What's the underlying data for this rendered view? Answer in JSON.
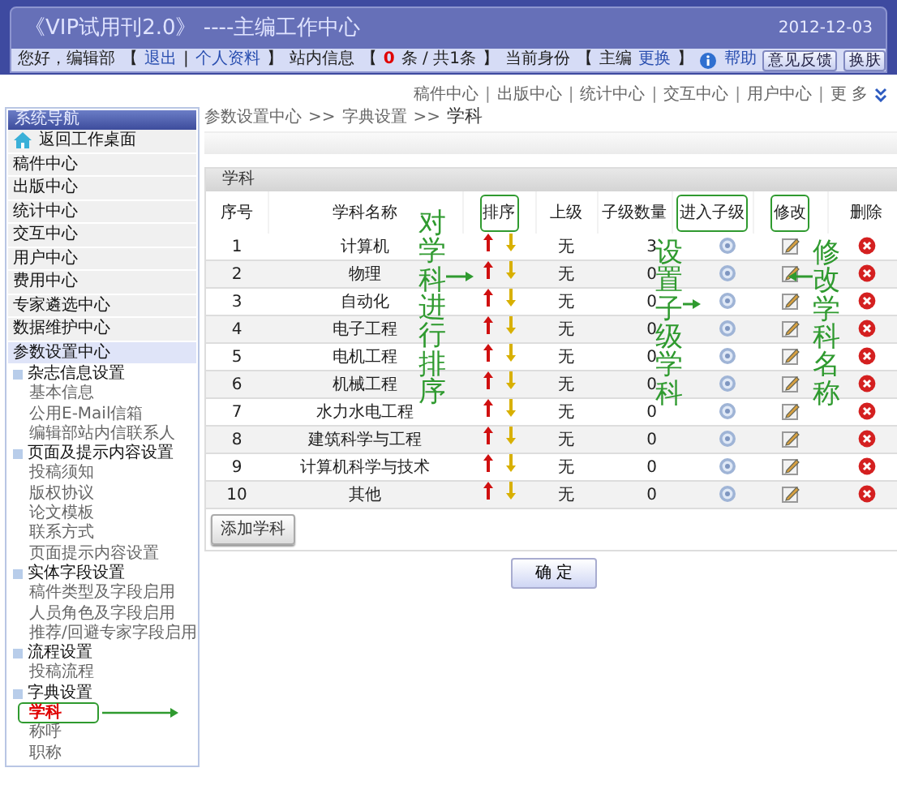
{
  "header": {
    "title": "《VIP试用刊2.0》 ----主编工作中心",
    "date": "2012-12-03"
  },
  "user_bar_left": [
    {
      "kind": "text",
      "text": "您好，编辑部"
    },
    {
      "kind": "text",
      "text": "【"
    },
    {
      "kind": "link",
      "text": "退出"
    },
    {
      "kind": "text",
      "text": "|"
    },
    {
      "kind": "link",
      "text": "个人资料"
    },
    {
      "kind": "text",
      "text": "】"
    }
  ],
  "user_bar_right": [
    {
      "kind": "text",
      "text": "站内信息"
    },
    {
      "kind": "text",
      "text": "【"
    },
    {
      "kind": "count",
      "text": "0"
    },
    {
      "kind": "text",
      "text": "条 / 共1条"
    },
    {
      "kind": "text",
      "text": "】"
    },
    {
      "kind": "text",
      "text": "当前身份"
    },
    {
      "kind": "text",
      "text": "【"
    },
    {
      "kind": "text",
      "text": "主编"
    },
    {
      "kind": "link",
      "text": "更换"
    },
    {
      "kind": "text",
      "text": "】"
    },
    {
      "kind": "help",
      "text": "帮助"
    },
    {
      "kind": "button",
      "text": "意见反馈"
    },
    {
      "kind": "button",
      "text": "换肤"
    }
  ],
  "top_nav": {
    "separator": "|",
    "links": [
      "稿件中心",
      "出版中心",
      "统计中心",
      "交互中心",
      "用户中心"
    ],
    "more": "更 多"
  },
  "sidebar": {
    "title": "系统导航",
    "home": "返回工作桌面",
    "items": [
      {
        "label": "稿件中心",
        "selected": false
      },
      {
        "label": "出版中心",
        "selected": false
      },
      {
        "label": "统计中心",
        "selected": false
      },
      {
        "label": "交互中心",
        "selected": false
      },
      {
        "label": "用户中心",
        "selected": false
      },
      {
        "label": "费用中心",
        "selected": false
      },
      {
        "label": "专家遴选中心",
        "selected": false
      },
      {
        "label": "数据维护中心",
        "selected": false
      },
      {
        "label": "参数设置中心",
        "selected": true,
        "children": [
          {
            "label": "杂志信息设置",
            "children": [
              {
                "label": "基本信息",
                "selected": false,
                "highlighted": false
              },
              {
                "label": "公用E-Mail信箱",
                "selected": false,
                "highlighted": false
              },
              {
                "label": "编辑部站内信联系人",
                "selected": false,
                "highlighted": false
              }
            ]
          },
          {
            "label": "页面及提示内容设置",
            "children": [
              {
                "label": "投稿须知",
                "selected": false,
                "highlighted": false
              },
              {
                "label": "版权协议",
                "selected": false,
                "highlighted": false
              },
              {
                "label": "论文模板",
                "selected": false,
                "highlighted": false
              },
              {
                "label": "联系方式",
                "selected": false,
                "highlighted": false
              },
              {
                "label": "页面提示内容设置",
                "selected": false,
                "highlighted": false
              }
            ]
          },
          {
            "label": "实体字段设置",
            "children": [
              {
                "label": "稿件类型及字段启用",
                "selected": false,
                "highlighted": false
              },
              {
                "label": "人员角色及字段启用",
                "selected": false,
                "highlighted": false
              },
              {
                "label": "推荐/回避专家字段启用",
                "selected": false,
                "highlighted": false
              }
            ]
          },
          {
            "label": "流程设置",
            "children": [
              {
                "label": "投稿流程",
                "selected": false,
                "highlighted": false
              }
            ]
          },
          {
            "label": "字典设置",
            "children": [
              {
                "label": "学科",
                "selected": true,
                "highlighted": true
              },
              {
                "label": "称呼",
                "selected": false,
                "highlighted": false
              },
              {
                "label": "职称",
                "selected": false,
                "highlighted": false
              }
            ]
          }
        ]
      }
    ]
  },
  "breadcrumb": {
    "separator": ">>",
    "items": [
      "参数设置中心",
      "字典设置",
      "学科"
    ]
  },
  "panel": {
    "title": "学科",
    "columns": [
      {
        "label": "序号",
        "highlighted": false
      },
      {
        "label": "学科名称",
        "highlighted": false
      },
      {
        "label": "排序",
        "highlighted": true
      },
      {
        "label": "上级",
        "highlighted": false
      },
      {
        "label": "子级数量",
        "highlighted": false
      },
      {
        "label": "进入子级",
        "highlighted": true
      },
      {
        "label": "修改",
        "highlighted": true
      },
      {
        "label": "删除",
        "highlighted": false
      }
    ],
    "rows": [
      {
        "no": "1",
        "name": "计算机",
        "parent": "无",
        "child_count": "3"
      },
      {
        "no": "2",
        "name": "物理",
        "parent": "无",
        "child_count": "0"
      },
      {
        "no": "3",
        "name": "自动化",
        "parent": "无",
        "child_count": "0"
      },
      {
        "no": "4",
        "name": "电子工程",
        "parent": "无",
        "child_count": "0"
      },
      {
        "no": "5",
        "name": "电机工程",
        "parent": "无",
        "child_count": "0"
      },
      {
        "no": "6",
        "name": "机械工程",
        "parent": "无",
        "child_count": "0"
      },
      {
        "no": "7",
        "name": "水力水电工程",
        "parent": "无",
        "child_count": "0"
      },
      {
        "no": "8",
        "name": "建筑科学与工程",
        "parent": "无",
        "child_count": "0"
      },
      {
        "no": "9",
        "name": "计算机科学与技术",
        "parent": "无",
        "child_count": "0"
      },
      {
        "no": "10",
        "name": "其他",
        "parent": "无",
        "child_count": "0"
      }
    ],
    "add_button": "添加学科"
  },
  "confirm_button": "确 定",
  "callouts": [
    {
      "text": "对学科进行排序",
      "points_left": false
    },
    {
      "text": "设置子级学科",
      "points_left": false
    },
    {
      "text": "修改学科名称",
      "points_left": true
    }
  ]
}
